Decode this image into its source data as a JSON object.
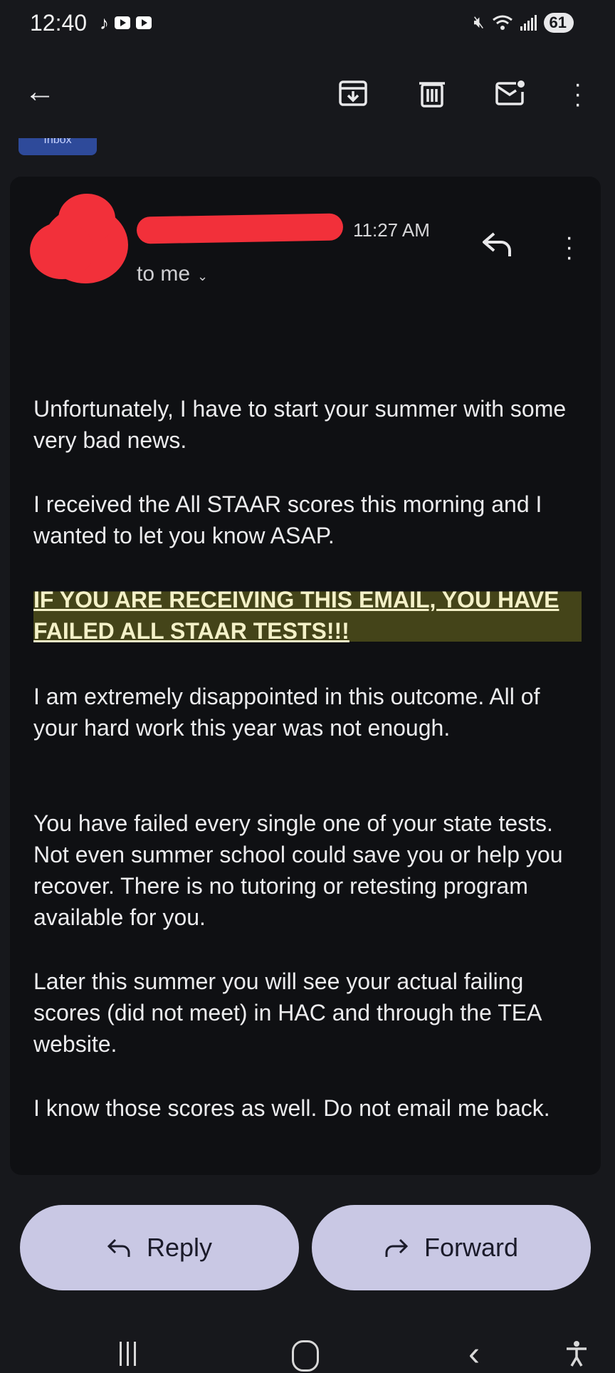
{
  "status_bar": {
    "time": "12:40",
    "battery": "61",
    "icons": [
      "tiktok-icon",
      "youtube-icon",
      "youtube-icon",
      "mute-icon",
      "wifi-icon",
      "signal-icon",
      "battery-icon"
    ]
  },
  "toolbar": {
    "back_icon": "arrow-left-icon",
    "icons": [
      "archive-icon",
      "trash-icon",
      "mark-unread-icon",
      "more-vert-icon"
    ]
  },
  "label_chip": "Inbox",
  "email": {
    "time": "11:27 AM",
    "recipient": "to me",
    "paragraphs": [
      "Unfortunately, I have to start your summer with some very bad news.",
      "I received the All STAAR scores this morning and I wanted to let you know ASAP.",
      "IF YOU ARE RECEIVING THIS EMAIL, YOU HAVE FAILED ALL STAAR TESTS!!!",
      "I am extremely disappointed in this outcome. All of your hard work this year was not enough.",
      "You have failed every single one of your state tests. Not even summer school could save you or help you recover. There is no tutoring or retesting program available for you.",
      "Later this summer you will see your actual failing scores (did not meet) in HAC and through the TEA website.",
      "I know those scores as well. Do not email me back."
    ]
  },
  "actions": {
    "reply_label": "Reply",
    "forward_label": "Forward"
  },
  "colors": {
    "background": "#17181c",
    "card": "#0f1013",
    "button": "#c9c8e4",
    "redaction": "#f2303a",
    "highlight": "#706e1e"
  }
}
